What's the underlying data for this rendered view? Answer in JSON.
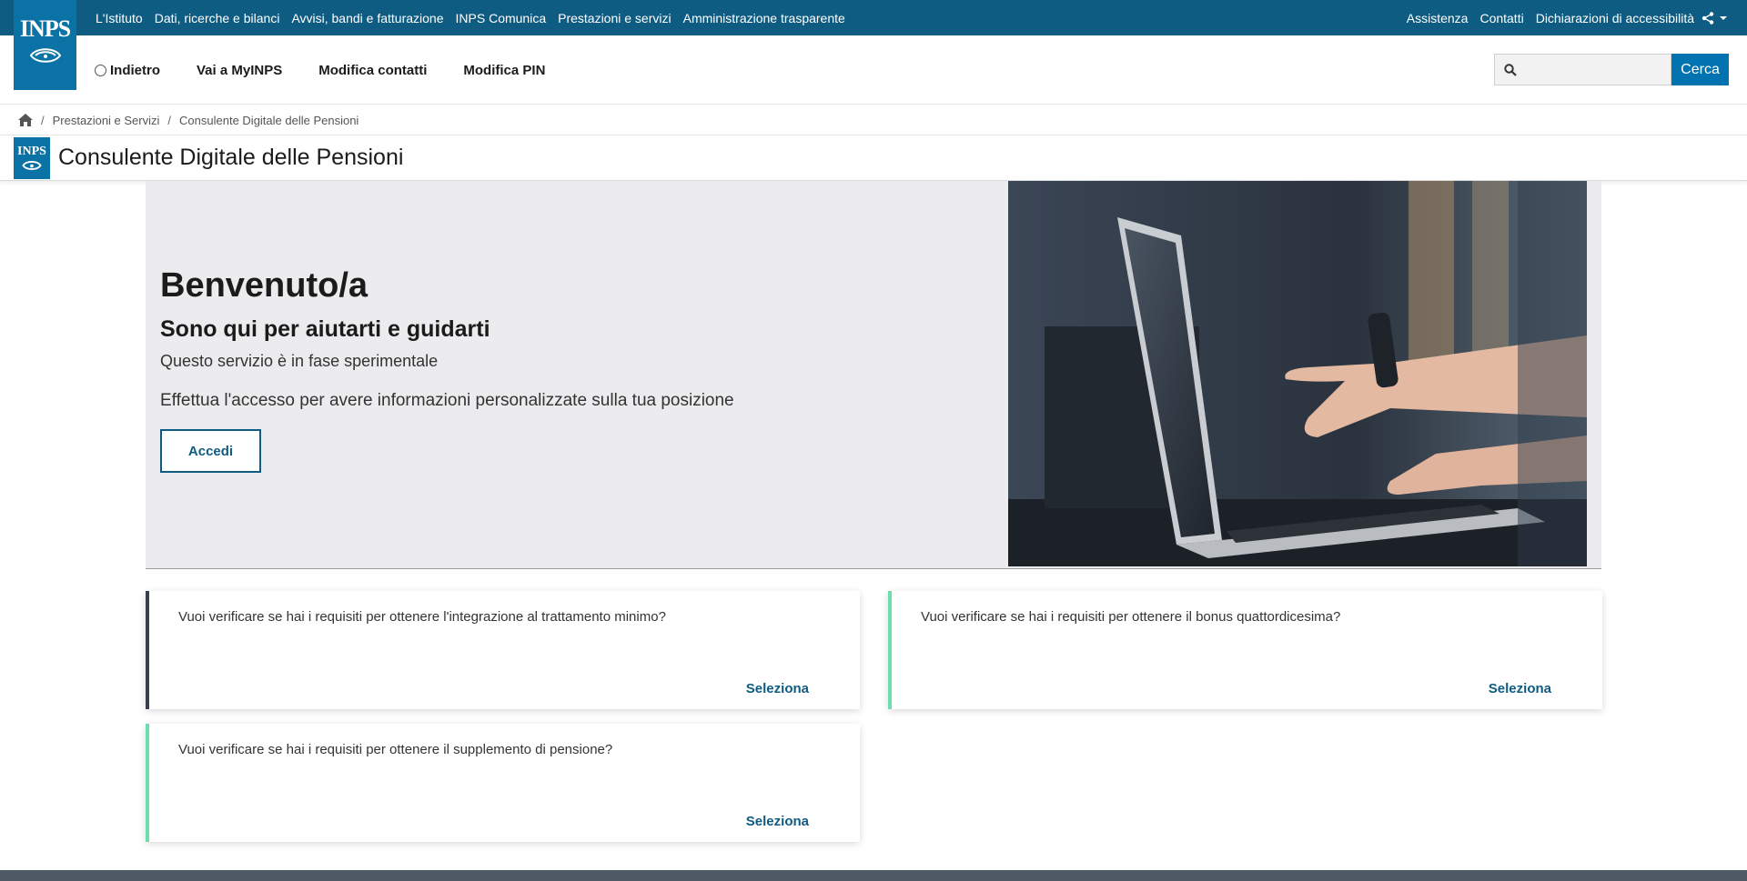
{
  "logo": {
    "text": "INPS"
  },
  "top_nav": {
    "left": [
      "L'Istituto",
      "Dati, ricerche e bilanci",
      "Avvisi, bandi e fatturazione",
      "INPS Comunica",
      "Prestazioni e servizi",
      "Amministrazione trasparente"
    ],
    "right": [
      "Assistenza",
      "Contatti",
      "Dichiarazioni di accessibilità"
    ]
  },
  "sub_nav": {
    "back": "Indietro",
    "items": [
      "Vai a MyINPS",
      "Modifica contatti",
      "Modifica PIN"
    ]
  },
  "search": {
    "placeholder": "",
    "button": "Cerca"
  },
  "breadcrumb": {
    "items": [
      "Prestazioni e Servizi",
      "Consulente Digitale delle Pensioni"
    ]
  },
  "page_title": "Consulente Digitale delle Pensioni",
  "hero": {
    "heading": "Benvenuto/a",
    "subheading": "Sono qui per aiutarti e guidarti",
    "note": "Questo servizio è in fase sperimentale",
    "description": "Effettua l'accesso per avere informazioni personalizzate sulla tua posizione",
    "button": "Accedi"
  },
  "cards": [
    {
      "question": "Vuoi verificare se hai i requisiti per ottenere l'integrazione al trattamento minimo?",
      "link": "Seleziona"
    },
    {
      "question": "Vuoi verificare se hai i requisiti per ottenere il bonus quattordicesima?",
      "link": "Seleziona"
    },
    {
      "question": "Vuoi verificare se hai i requisiti per ottenere il supplemento di pensione?",
      "link": "Seleziona"
    }
  ],
  "colors": {
    "brand_dark": "#0f5c82",
    "brand": "#0b72a6",
    "accent_green": "#6fdcaf",
    "search_button": "#0073b0"
  },
  "icons": {
    "home": "home-icon",
    "search": "search-icon",
    "share": "share-icon",
    "chevron": "chevron-down-icon"
  }
}
